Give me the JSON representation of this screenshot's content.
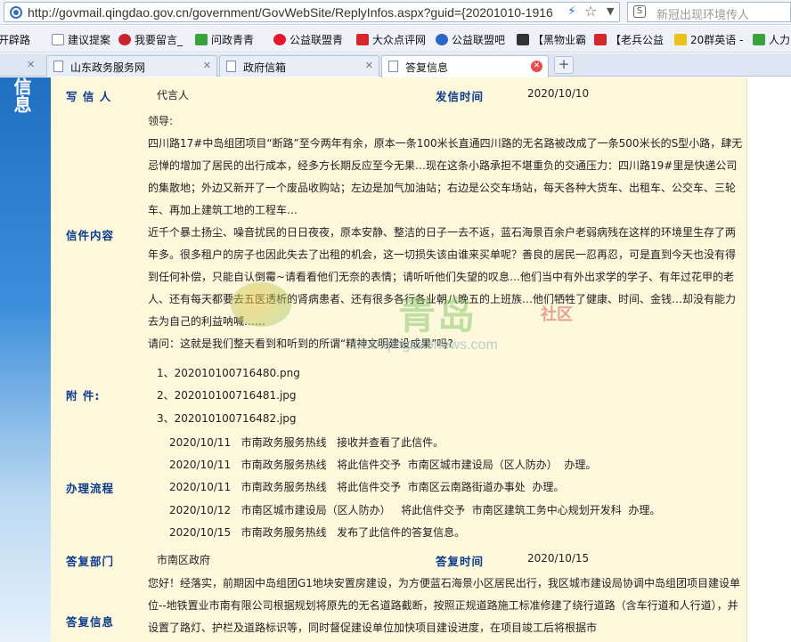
{
  "browser": {
    "url": "http://govmail.qingdao.gov.cn/government/GovWebSite/ReplyInfos.aspx?guid={20201010-1916",
    "search_placeholder": "新冠出现环境传人",
    "favorites": [
      {
        "label": "开辟路",
        "icon": "page"
      },
      {
        "label": "建议提案",
        "icon": "page"
      },
      {
        "label": "我要留言_",
        "icon": "emblem"
      },
      {
        "label": "问政青青",
        "icon": "green"
      },
      {
        "label": "公益联盟青",
        "icon": "weibo"
      },
      {
        "label": "大众点评网",
        "icon": "red"
      },
      {
        "label": "公益联盟吧",
        "icon": "paw"
      },
      {
        "label": "【黑物业霸",
        "icon": "dark"
      },
      {
        "label": "【老兵公益",
        "icon": "red"
      },
      {
        "label": "20群英语 -",
        "icon": "yellow"
      },
      {
        "label": "人力",
        "icon": "green"
      }
    ],
    "tabs": [
      {
        "label": "山东政务服务网",
        "active": false
      },
      {
        "label": "政府信箱",
        "active": false
      },
      {
        "label": "答复信息",
        "active": true
      }
    ],
    "new_tab_label": "+"
  },
  "banner": {
    "text": "信息"
  },
  "letter": {
    "writer_label": "写 信 人",
    "writer": "代言人",
    "sent_time_label": "发信时间",
    "sent_time": "2020/10/10",
    "content_label": "信件内容",
    "paragraphs": [
      "领导:",
      "四川路17#中岛组团项目“断路”至今两年有余，原本一条100米长直通四川路的无名路被改成了一条500米长的S型小路，肆无忌惮的增加了居民的出行成本，经多方长期反应至今无果…现在这条小路承担不堪重负的交通压力：四川路19#里是快递公司的集散地；外边又新开了一个废品收购站；左边是加气加油站；右边是公交车场站，每天各种大货车、出租车、公交车、三轮车、再加上建筑工地的工程车…",
      "近千个暴土扬尘、噪音扰民的日日夜夜，原本安静、整洁的日子一去不返，蓝石海景百余户老弱病残在这样的环境里生存了两年多。很多租户的房子也因此失去了出租的机会，这一切损失该由谁来买单呢？善良的居民一忍再忍，可是直到今天也没有得到任何补偿，只能自认倒霉~请看看他们无奈的表情；请听听他们失望的叹息…他们当中有外出求学的学子、有年过花甲的老人、还有每天都要去五医透析的肾病患者、还有很多各行各业朝八晚五的上班族…他们牺牲了健康、时间、金钱…却没有能力去为自己的利益呐喊……",
      "请问：这就是我们整天看到和听到的所谓“精神文明建设成果”吗?"
    ],
    "attachments_label": "附 件:",
    "attachments": [
      "1、202010100716480.png",
      "2、202010100716481.jpg",
      "3、202010100716482.jpg"
    ],
    "process_label": "办理流程",
    "process": [
      {
        "date": "2020/10/11",
        "text": "市南政务服务热线   接收并查看了此信件。"
      },
      {
        "date": "2020/10/11",
        "text": "市南政务服务热线   将此信件交予  市南区城市建设局（区人防办）  办理。"
      },
      {
        "date": "2020/10/11",
        "text": "市南政务服务热线   将此信件交予  市南区云南路街道办事处  办理。"
      },
      {
        "date": "2020/10/12",
        "text": "市南区城市建设局（区人防办）   将此信件交予  市南区建筑工务中心规划开发科  办理。"
      },
      {
        "date": "2020/10/15",
        "text": "市南政务服务热线   发布了此信件的答复信息。"
      }
    ],
    "reply_dept_label": "答复部门",
    "reply_dept": "市南区政府",
    "reply_time_label": "答复时间",
    "reply_time": "2020/10/15",
    "reply_info_label": "答复信息",
    "reply_text": "您好！经落实，前期因中岛组团G1地块安置房建设，为方便蓝石海景小区居民出行，我区城市建设局协调中岛组团项目建设单位--地铁置业市南有限公司根据规划将原先的无名道路截断，按照正规道路施工标准修建了绕行道路（含车行道和人行道），并设置了路灯、护栏及道路标识等，同时督促建设单位加快项目建设进度，在项目竣工后将根据市"
  },
  "watermark": {
    "big": "青岛",
    "small": "社区",
    "url": "club.qingdaonews.com"
  }
}
